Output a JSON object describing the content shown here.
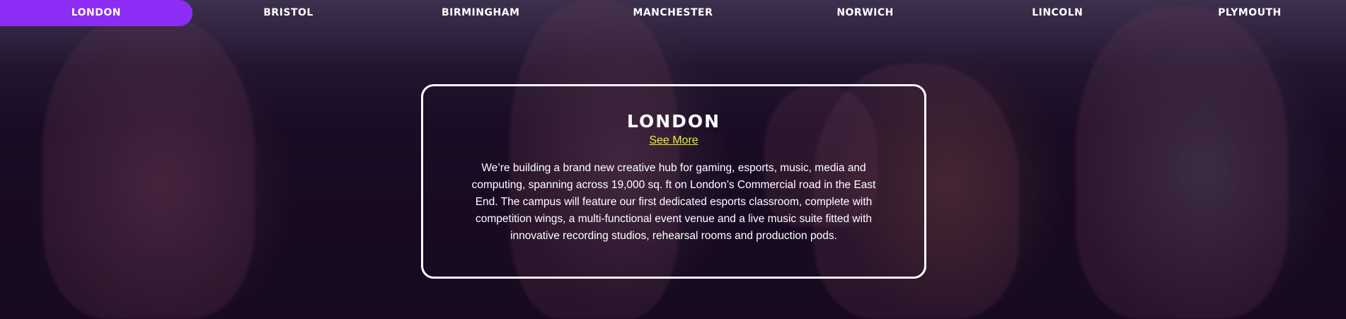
{
  "nav": {
    "items": [
      {
        "label": "LONDON",
        "active": true
      },
      {
        "label": "BRISTOL",
        "active": false
      },
      {
        "label": "BIRMINGHAM",
        "active": false
      },
      {
        "label": "MANCHESTER",
        "active": false
      },
      {
        "label": "NORWICH",
        "active": false
      },
      {
        "label": "LINCOLN",
        "active": false
      },
      {
        "label": "PLYMOUTH",
        "active": false
      }
    ],
    "active_color": "#8c2cf5"
  },
  "card": {
    "title": "LONDON",
    "link_label": "See More",
    "link_color": "#e6f22a",
    "body": "We’re building a brand new creative hub for gaming, esports, music, media and computing, spanning across 19,000 sq. ft on London’s Commercial road in the East End. The campus will feature our first dedicated esports classroom, complete with competition wings, a multi-functional event venue and a live music suite fitted with innovative recording studios, rehearsal rooms and production pods."
  },
  "background": {
    "image": "band-performing-on-stage-photo"
  }
}
